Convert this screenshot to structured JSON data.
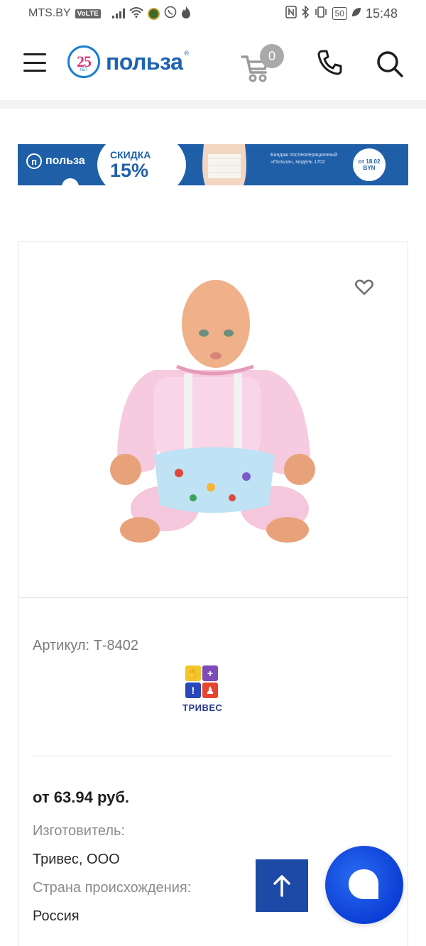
{
  "status_bar": {
    "carrier": "MTS.BY",
    "volte": "VoLTE",
    "battery": "50",
    "time": "15:48"
  },
  "header": {
    "logo_badge": "25",
    "logo_badge_sub": "ЛЕТ",
    "logo_text": "польза",
    "logo_reg": "®",
    "cart_count": "0"
  },
  "banner": {
    "logo_letter": "п",
    "logo_text": "польза",
    "promo_label": "СКИДКА",
    "promo_value": "15%",
    "description": "Бандаж послеоперационный «Польза», модель 1702",
    "price_from": "от 18.02",
    "price_currency": "BYN"
  },
  "product": {
    "sku": "Артикул: Т-8402",
    "brand_name": "ТРИВЕС",
    "price": "от 63.94 руб.",
    "manufacturer_label": "Изготовитель:",
    "manufacturer_value": "Тривес, ООО",
    "country_label": "Страна происхождения:",
    "country_value": "Россия"
  },
  "colors": {
    "brand_blue": "#1e62b3",
    "banner_blue": "#1f5fa8",
    "to_top_blue": "#1c4aa6",
    "chat_blue": "#0b3ed6"
  }
}
